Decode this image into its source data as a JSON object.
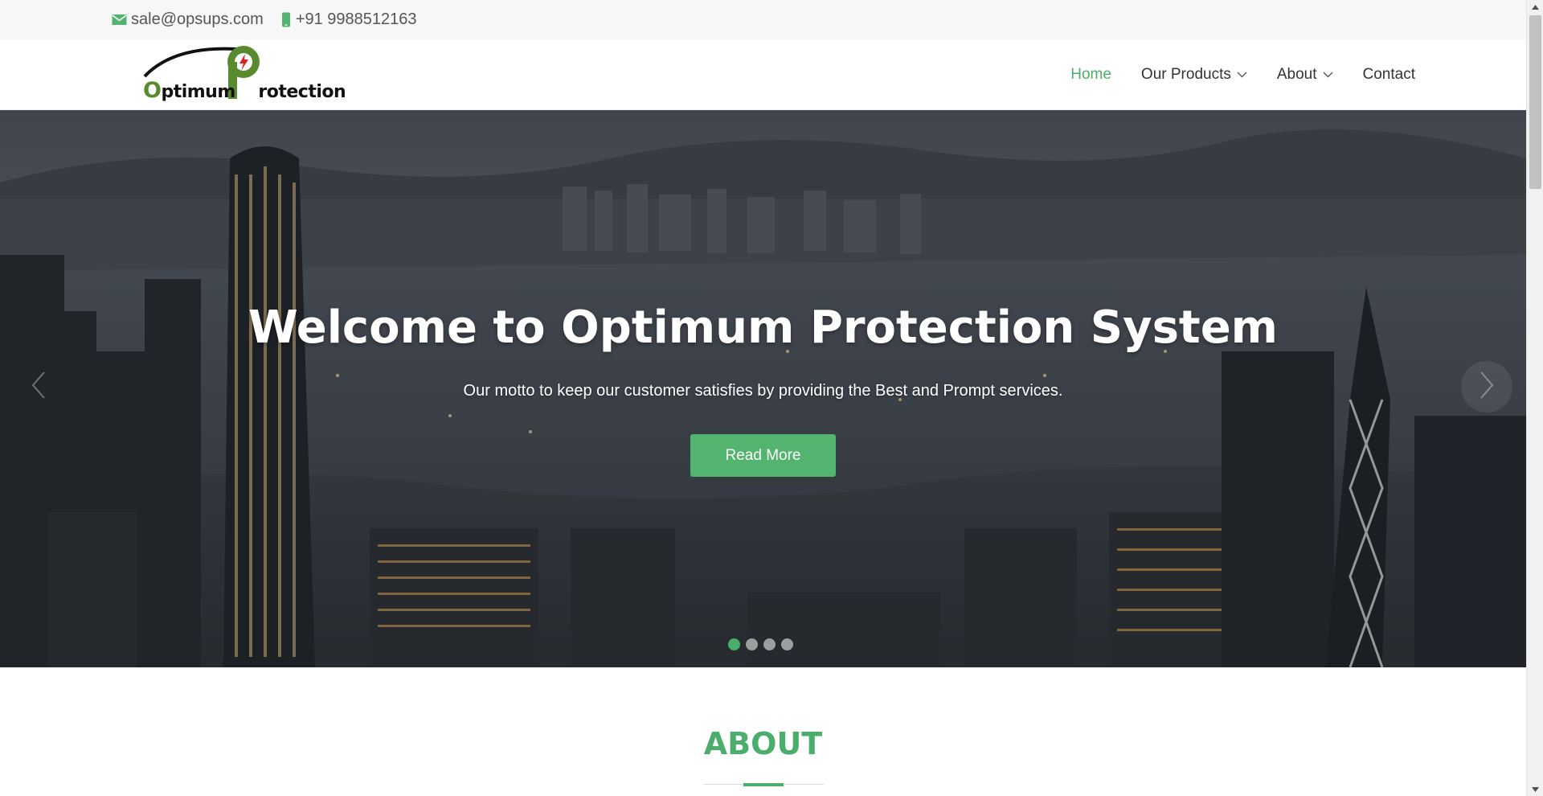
{
  "topbar": {
    "email": "sale@opsups.com",
    "phone": "+91 9988512163",
    "email_icon": "envelope-icon",
    "phone_icon": "mobile-phone-icon"
  },
  "logo": {
    "name": "Optimum Protection"
  },
  "nav": {
    "items": [
      {
        "label": "Home",
        "active": true,
        "has_dropdown": false
      },
      {
        "label": "Our Products",
        "active": false,
        "has_dropdown": true
      },
      {
        "label": "About",
        "active": false,
        "has_dropdown": true
      },
      {
        "label": "Contact",
        "active": false,
        "has_dropdown": false
      }
    ]
  },
  "hero": {
    "title": "Welcome to Optimum Protection System",
    "subtitle": "Our motto to keep our customer satisfies by providing the Best and Prompt services.",
    "cta_label": "Read More",
    "slide_count": 4,
    "active_slide": 1
  },
  "about": {
    "title": "ABOUT"
  },
  "colors": {
    "accent": "#4cae6c",
    "button": "#52b46e",
    "topbar_bg": "#f7f7f7",
    "logo_green": "#5a8a2e",
    "logo_bolt": "#e02020"
  }
}
